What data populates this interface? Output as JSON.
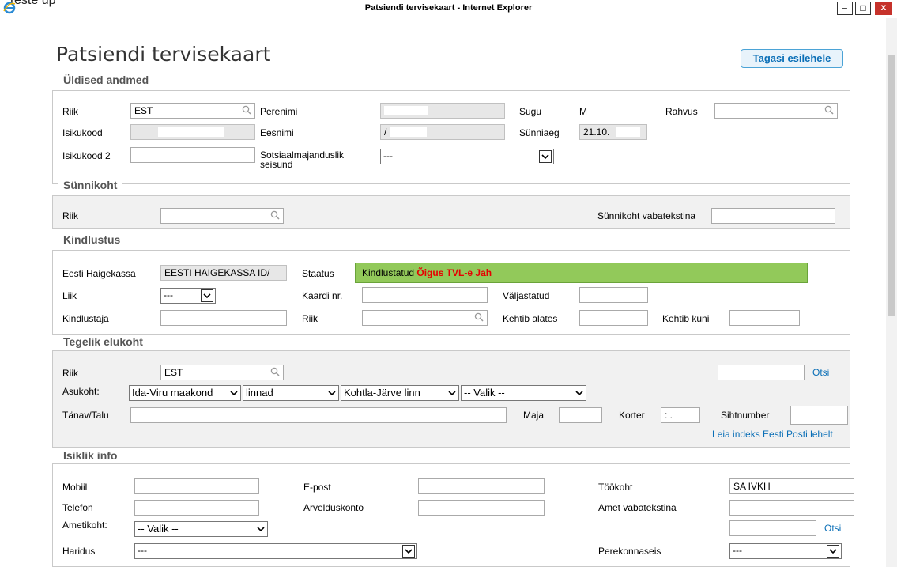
{
  "window": {
    "title": "Patsiendi tervisekaart - Internet Explorer",
    "top_fragment": "Teste   up",
    "btn_min": "–",
    "btn_max": "□",
    "btn_close": "x"
  },
  "page": {
    "title": "Patsiendi tervisekaart",
    "back_button": "Tagasi esilehele"
  },
  "yldised": {
    "legend": "Üldised andmed",
    "riik_label": "Riik",
    "riik_value": "EST",
    "perenimi_label": "Perenimi",
    "perenimi_value": "",
    "sugu_label": "Sugu",
    "sugu_value": "M",
    "rahvus_label": "Rahvus",
    "rahvus_value": "",
    "isikukood_label": "Isikukood",
    "isikukood_value": "",
    "eesnimi_label": "Eesnimi",
    "eesnimi_value": "/",
    "synniaeg_label": "Sünniaeg",
    "synniaeg_value": "21.10.",
    "isikukood2_label": "Isikukood 2",
    "isikukood2_value": "",
    "sotsiaal_label_1": "Sotsiaalmajanduslik",
    "sotsiaal_label_2": "seisund",
    "sotsiaal_value": "---"
  },
  "synnikoht": {
    "legend": "Sünnikoht",
    "riik_label": "Riik",
    "riik_value": "",
    "vabatekst_label": "Sünnikoht vabatekstina",
    "vabatekst_value": ""
  },
  "kindlustus": {
    "legend": "Kindlustus",
    "haigekassa_label": "Eesti Haigekassa",
    "haigekassa_value": "EESTI HAIGEKASSA ID/",
    "staatus_label": "Staatus",
    "staatus_text": "Kindlustatud",
    "staatus_red": "Õigus TVL-e Jah",
    "liik_label": "Liik",
    "liik_value": "---",
    "kaardi_label": "Kaardi nr.",
    "kaardi_value": "",
    "valjastatud_label": "Väljastatud",
    "valjastatud_value": "",
    "kindlustaja_label": "Kindlustaja",
    "kindlustaja_value": "",
    "riik_label": "Riik",
    "riik_value": "",
    "alates_label": "Kehtib alates",
    "alates_value": "",
    "kuni_label": "Kehtib kuni",
    "kuni_value": ""
  },
  "elukoht": {
    "legend": "Tegelik elukoht",
    "riik_label": "Riik",
    "riik_value": "EST",
    "search_value": "",
    "otsi_link": "Otsi",
    "asukoht_label": "Asukoht:",
    "maakond": "Ida-Viru maakond",
    "linnad": "linnad",
    "linn": "Kohtla-Järve linn",
    "valik": "-- Valik --",
    "tanav_label": "Tänav/Talu",
    "tanav_value": "",
    "maja_label": "Maja",
    "maja_value": "",
    "korter_label": "Korter",
    "korter_value": ": .",
    "sihtnumber_label": "Sihtnumber",
    "sihtnumber_value": "",
    "leia_link": "Leia indeks Eesti Posti lehelt"
  },
  "isiklik": {
    "legend": "Isiklik info",
    "mobiil_label": "Mobiil",
    "mobiil_value": "",
    "epost_label": "E-post",
    "epost_value": "",
    "tookoht_label": "Töökoht",
    "tookoht_value": "SA IVKH",
    "telefon_label": "Telefon",
    "telefon_value": "",
    "arveldus_label": "Arvelduskonto",
    "arveldus_value": "",
    "amet_label": "Amet vabatekstina",
    "amet_value": "",
    "ametikoht_label": "Ametikoht:",
    "ametikoht_value": "-- Valik --",
    "otsi_link": "Otsi",
    "haridus_label": "Haridus",
    "haridus_value": "---",
    "perekonnaseis_label": "Perekonnaseis",
    "perekonnaseis_value": "---"
  }
}
